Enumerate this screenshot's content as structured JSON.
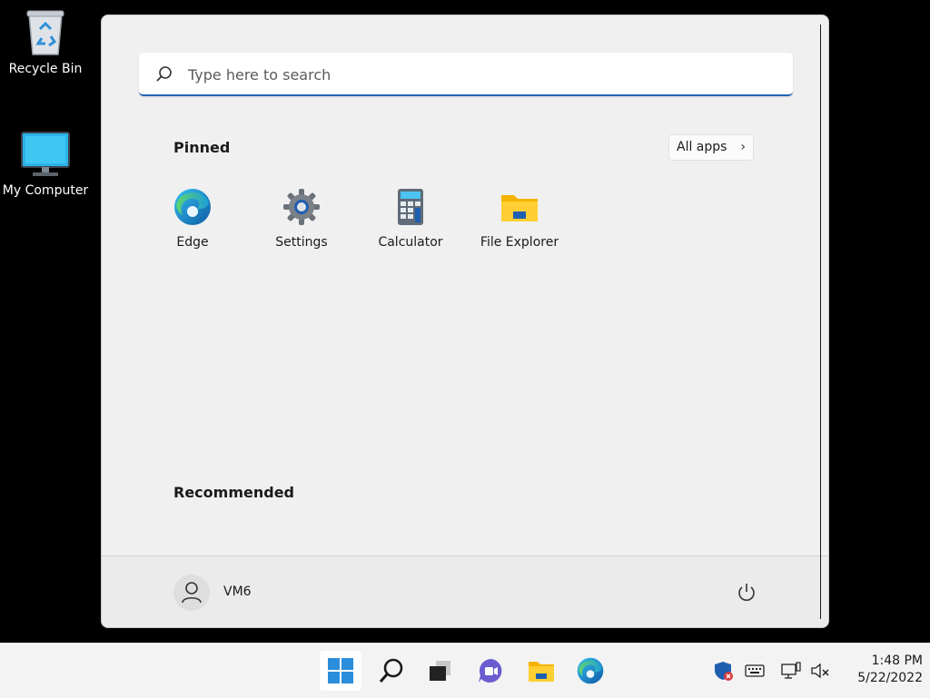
{
  "desktop": {
    "icons": [
      {
        "label": "Recycle Bin",
        "icon": "recycle-bin-icon"
      },
      {
        "label": "My Computer",
        "icon": "monitor-icon"
      }
    ]
  },
  "start_menu": {
    "search": {
      "placeholder": "Type here to search",
      "value": ""
    },
    "pinned": {
      "title": "Pinned",
      "all_apps_label": "All apps",
      "apps": [
        {
          "label": "Edge",
          "icon": "edge-icon"
        },
        {
          "label": "Settings",
          "icon": "gear-icon"
        },
        {
          "label": "Calculator",
          "icon": "calculator-icon"
        },
        {
          "label": "File Explorer",
          "icon": "folder-icon"
        }
      ]
    },
    "recommended": {
      "title": "Recommended"
    },
    "footer": {
      "username": "VM6",
      "power_icon": "power-icon"
    }
  },
  "taskbar": {
    "items": [
      "start-icon",
      "search-icon",
      "task-view-icon",
      "chat-icon",
      "file-explorer-icon",
      "edge-icon"
    ],
    "tray": [
      "security-icon",
      "keyboard-icon",
      "network-icon",
      "volume-muted-icon"
    ],
    "time": "1:48 PM",
    "date": "5/22/2022"
  },
  "colors": {
    "accent": "#1f64b4",
    "start_bg": "#f0f0f0",
    "taskbar_bg": "#f3f3f3",
    "desktop_bg": "#000000"
  }
}
